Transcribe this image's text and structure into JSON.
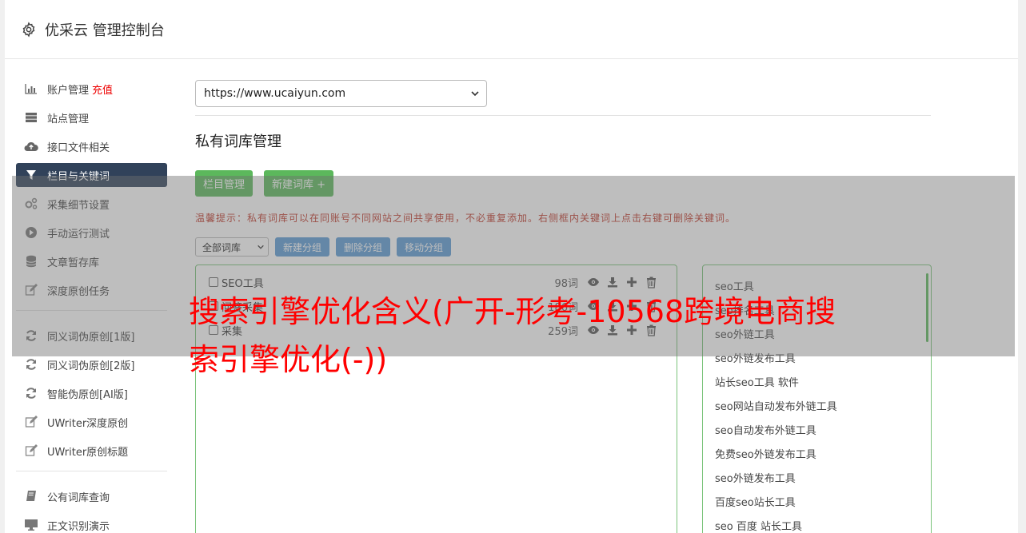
{
  "header": {
    "title": "优采云 管理控制台"
  },
  "sidebar": {
    "items": [
      {
        "label": "账户管理",
        "tag": "充值",
        "icon": "bar-chart-icon"
      },
      {
        "label": "站点管理",
        "icon": "server-icon"
      },
      {
        "label": "接口文件相关",
        "icon": "cloud-upload-icon"
      },
      {
        "label": "栏目与关键词",
        "icon": "filter-icon",
        "active": true
      },
      {
        "label": "采集细节设置",
        "icon": "gears-icon"
      },
      {
        "label": "手动运行测试",
        "icon": "play-icon"
      },
      {
        "label": "文章暂存库",
        "icon": "database-icon"
      },
      {
        "label": "深度原创任务",
        "icon": "edit-icon"
      }
    ],
    "items2": [
      {
        "label": "同义词伪原创[1版]",
        "icon": "refresh-icon"
      },
      {
        "label": "同义词伪原创[2版]",
        "icon": "refresh-icon"
      },
      {
        "label": "智能伪原创[AI版]",
        "icon": "refresh-icon"
      },
      {
        "label": "UWriter深度原创",
        "icon": "edit-icon"
      },
      {
        "label": "UWriter原创标题",
        "icon": "edit-icon"
      }
    ],
    "items3": [
      {
        "label": "公有词库查询",
        "icon": "book-icon"
      },
      {
        "label": "正文识别演示",
        "icon": "monitor-icon"
      }
    ]
  },
  "main": {
    "site_select": "https://www.ucaiyun.com",
    "section_title": "私有词库管理",
    "btn_column": "栏目管理",
    "btn_new_lib": "新建词库 +",
    "tip": "温馨提示：私有词库可以在同账号不同网站之间共享使用，不必重复添加。右侧框内关键词上点击右键可删除关键词。",
    "filter_select": "全部词库",
    "btn_new_group": "新建分组",
    "btn_delete_group": "删除分组",
    "btn_move_group": "移动分组",
    "groups": [
      {
        "name": "SEO工具",
        "count": "98词"
      },
      {
        "name": "问答采集",
        "count": "186词"
      },
      {
        "name": "采集",
        "count": "259词"
      }
    ],
    "keywords": [
      "seo工具",
      "seo排名工具",
      "seo外链工具",
      "seo外链发布工具",
      "站长seo工具 软件",
      "seo网站自动发布外链工具",
      "seo自动发布外链工具",
      "免费seo外链发布工具",
      "seo外链发布工具",
      "百度seo站长工具",
      "seo 百度 站长工具"
    ]
  },
  "overlay": {
    "headline": "搜索引擎优化含义(广开-形考-10568跨境电商搜索引擎优化(-))"
  }
}
